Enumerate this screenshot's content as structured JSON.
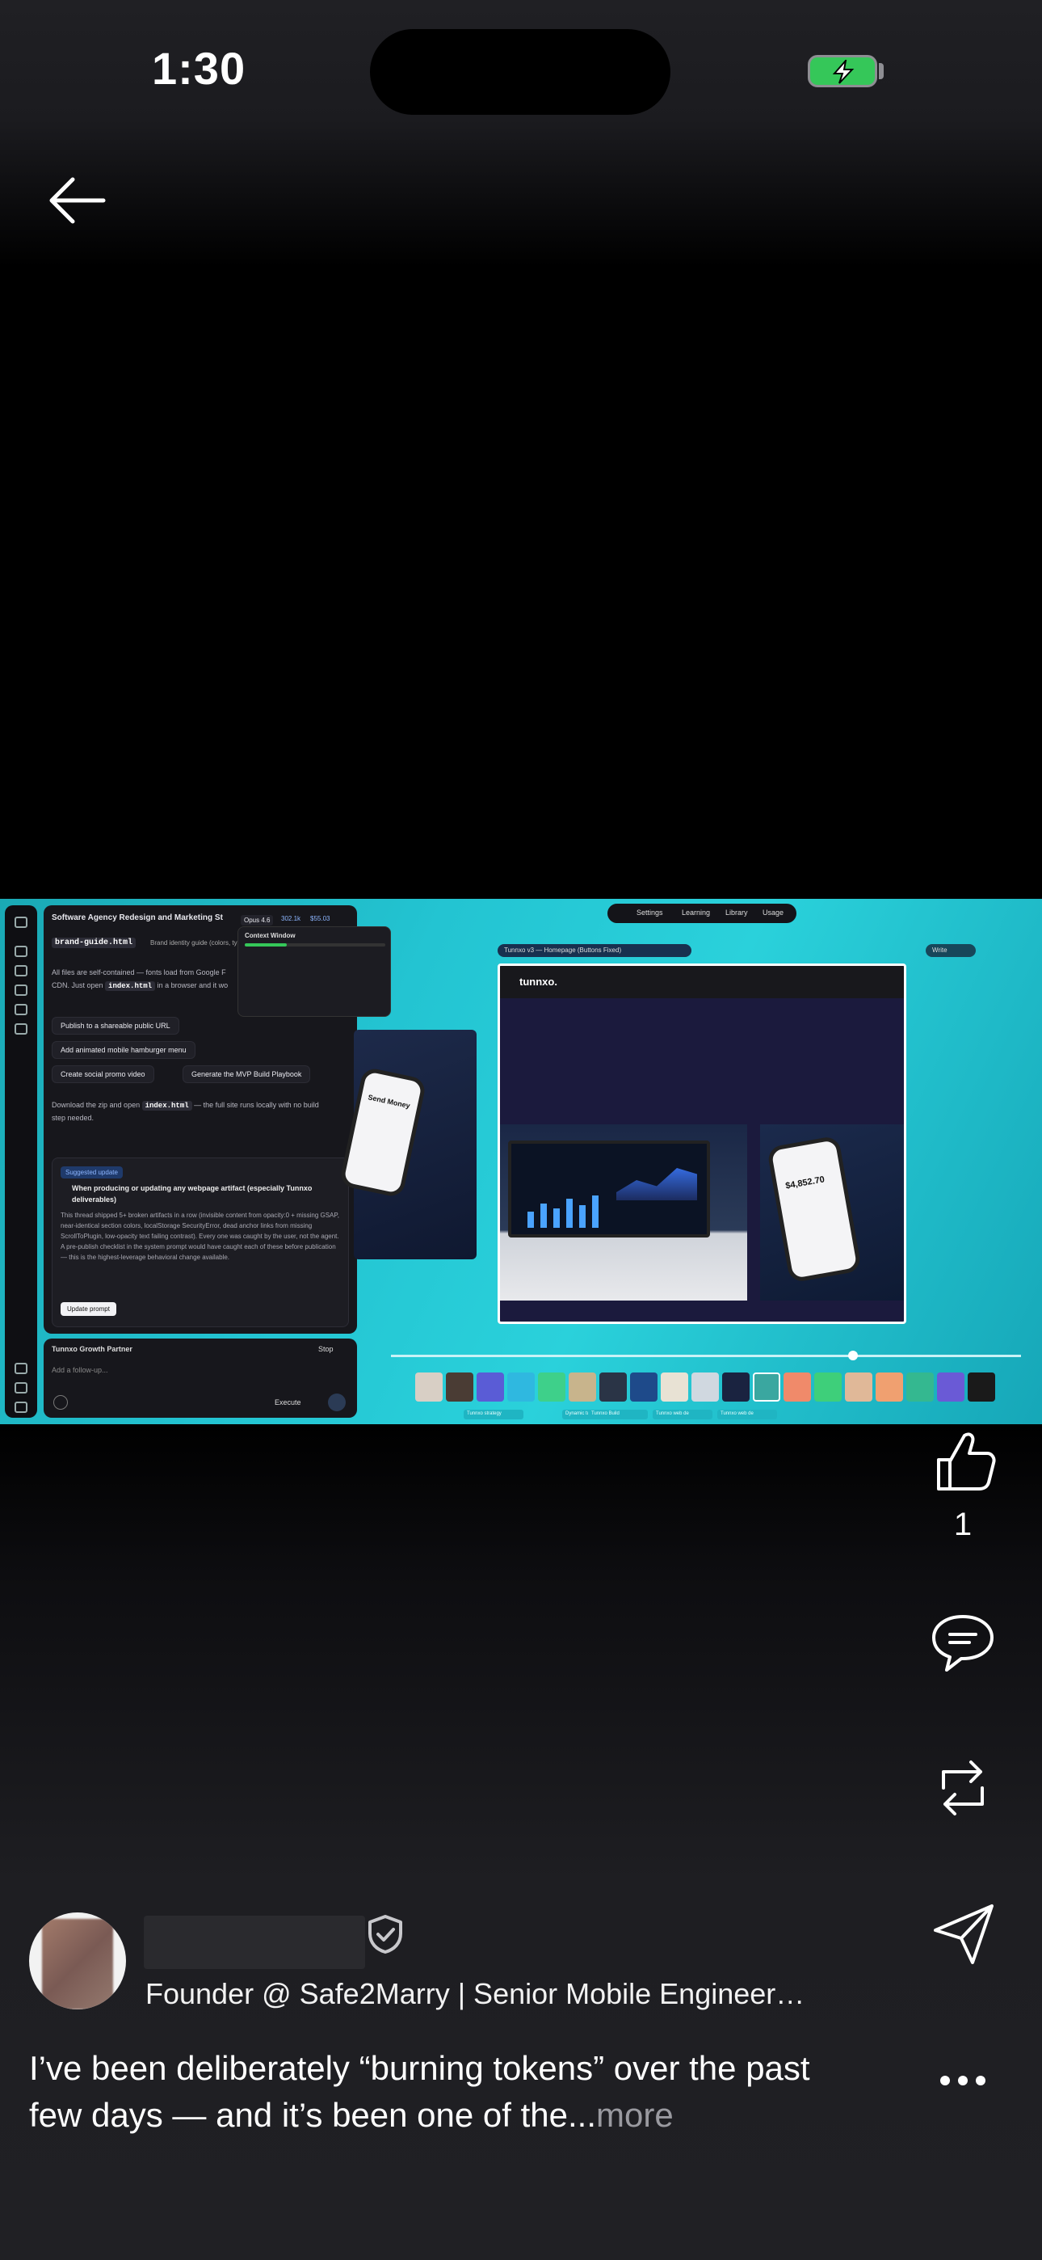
{
  "status_bar": {
    "time": "1:30"
  },
  "screenshot": {
    "chat_title": "Software Agency Redesign and Marketing St",
    "model_badge": "Opus 4.6",
    "tokens": "302.1k",
    "cost": "$55.03",
    "file_chip": "brand-guide.html",
    "file_desc": "Brand identity guide (colors, ty",
    "para1_a": "All files are self-contained — fonts load from Google F",
    "para1_b": "CDN. Just open",
    "para1_code": "index.html",
    "para1_c": "in a browser and it wo",
    "chip_publish": "Publish to a shareable public URL",
    "chip_menu": "Add animated mobile hamburger menu",
    "chip_video": "Create social promo video",
    "chip_mvp": "Generate the MVP Build Playbook",
    "para2_a": "Download the zip and open",
    "para2_code": "index.html",
    "para2_b": "— the full site runs locally with no build",
    "para2_c": "step needed.",
    "suggest_tag": "Suggested update",
    "suggest_title": "When producing or updating any webpage artifact (especially Tunnxo",
    "suggest_title2": "deliverables)",
    "suggest_body": "This thread shipped 5+ broken artifacts in a row (invisible content from opacity:0 + missing GSAP, near-identical section colors, localStorage SecurityError, dead anchor links from missing ScrollToPlugin, low-opacity text failing contrast). Every one was caught by the user, not the agent. A pre-publish checklist in the system prompt would have caught each of these before publication — this is the highest-leverage behavioral change available.",
    "update_btn": "Update prompt",
    "context_title": "Context Window",
    "partner_label": "Tunnxo Growth Partner",
    "stop_label": "Stop",
    "followup_placeholder": "Add a follow-up...",
    "execute_label": "Execute",
    "nav_settings": "Settings",
    "nav_learning": "Learning",
    "nav_library": "Library",
    "nav_usage": "Usage",
    "artifact_title": "Tunnxo v3 — Homepage (Buttons Fixed)",
    "write_label": "Write",
    "site_logo": "tunnxo.",
    "phone_text": "Send Money",
    "balance": "$4,852.70",
    "bottom_tabs": [
      "Tunnxo strategy",
      "Dynamic tunnxo",
      "Tunnxo Build",
      "Tunnxo web de",
      "Tunnxo web de"
    ]
  },
  "actions": {
    "like_count": "1"
  },
  "author": {
    "headline": "Founder @ Safe2Marry | Senior Mobile Engineer…"
  },
  "post": {
    "text": "I’ve been deliberately “burning tokens” over the past few days — and it’s been one of the...",
    "more": "more"
  }
}
